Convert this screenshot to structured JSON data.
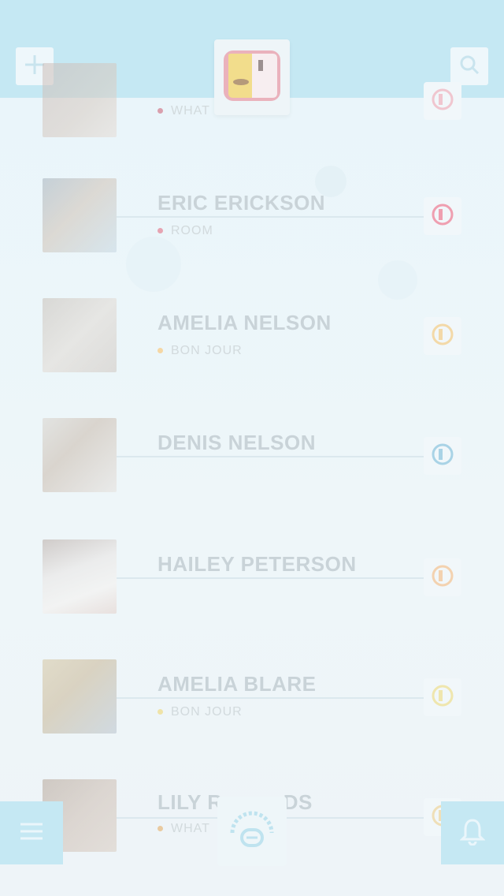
{
  "header": {
    "add_icon": "plus-icon",
    "search_icon": "search-icon",
    "logo_icon": "app-logo-icon"
  },
  "contacts": [
    {
      "name": "",
      "status": "WHAT",
      "status_suffix": "ID",
      "dot_color": "#d9a0ad",
      "btn_color": "#f0c6cf"
    },
    {
      "name": "ERIC ERICKSON",
      "status": "ROOM",
      "dot_color": "#e6a4b2",
      "btn_color": "#ef9fb0"
    },
    {
      "name": "AMELIA NELSON",
      "status": "BON JOUR",
      "dot_color": "#f5d7a4",
      "btn_color": "#f3d9a8"
    },
    {
      "name": "DENIS NELSON",
      "status": "",
      "dot_color": "",
      "btn_color": "#a9d3e6"
    },
    {
      "name": "HAILEY PETERSON",
      "status": "",
      "dot_color": "",
      "btn_color": "#f3d2b0"
    },
    {
      "name": "AMELIA BLARE",
      "status": "BON JOUR",
      "dot_color": "#efe3a8",
      "btn_color": "#efe6ae"
    },
    {
      "name": "LILY R",
      "name_suffix": "DS",
      "status": "WHAT",
      "status_suffix": "IC",
      "dot_color": "#e9caa0",
      "btn_color": "#efdfb8"
    }
  ],
  "footer": {
    "menu_icon": "hamburger-menu-icon",
    "center_icon": "headset-icon",
    "bell_icon": "bell-icon"
  },
  "colors": {
    "header_bg": "#c5e8f3",
    "accent": "#c5e8f3",
    "text_muted": "#c9d3d8"
  }
}
